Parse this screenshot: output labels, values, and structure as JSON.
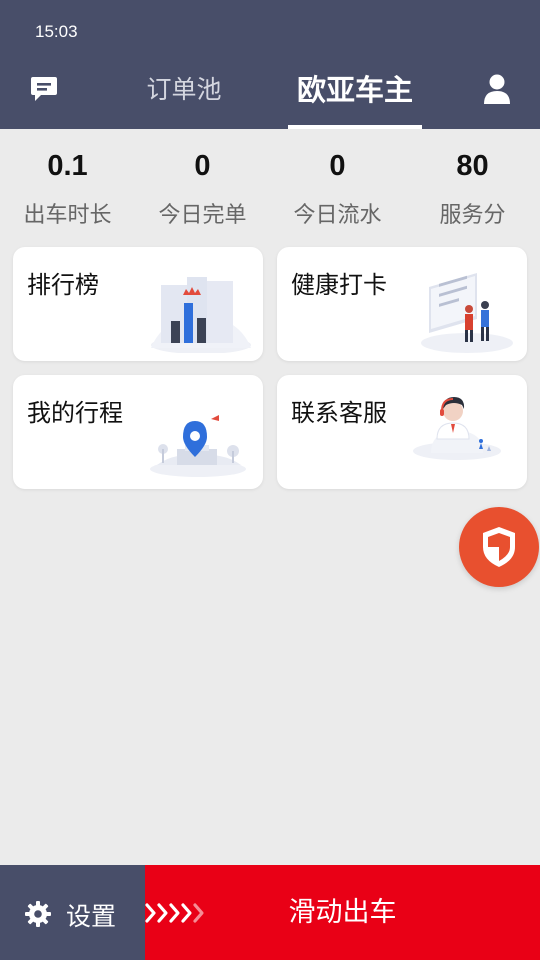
{
  "status_bar": {
    "time": "15:03"
  },
  "header": {
    "tabs": [
      {
        "label": "订单池",
        "active": false
      },
      {
        "label": "欧亚车主",
        "active": true
      }
    ],
    "message_icon": "chat-icon",
    "profile_icon": "user-icon"
  },
  "stats": [
    {
      "value": "0.1",
      "label": "出车时长"
    },
    {
      "value": "0",
      "label": "今日完单"
    },
    {
      "value": "0",
      "label": "今日流水"
    },
    {
      "value": "80",
      "label": "服务分"
    }
  ],
  "cards": [
    {
      "title": "排行榜",
      "icon": "leaderboard-icon"
    },
    {
      "title": "健康打卡",
      "icon": "health-checkin-icon"
    },
    {
      "title": "我的行程",
      "icon": "location-pin-icon"
    },
    {
      "title": "联系客服",
      "icon": "customer-service-icon"
    }
  ],
  "safety_button": {
    "icon": "shield-icon"
  },
  "bottom_bar": {
    "settings_label": "设置",
    "settings_icon": "gear-icon",
    "slide_label": "滑动出车",
    "slide_icon": "chevron-right-icon"
  },
  "colors": {
    "header": "#484e69",
    "background": "#ebebeb",
    "slide_bar": "#e90016",
    "safety": "#e8502f"
  }
}
